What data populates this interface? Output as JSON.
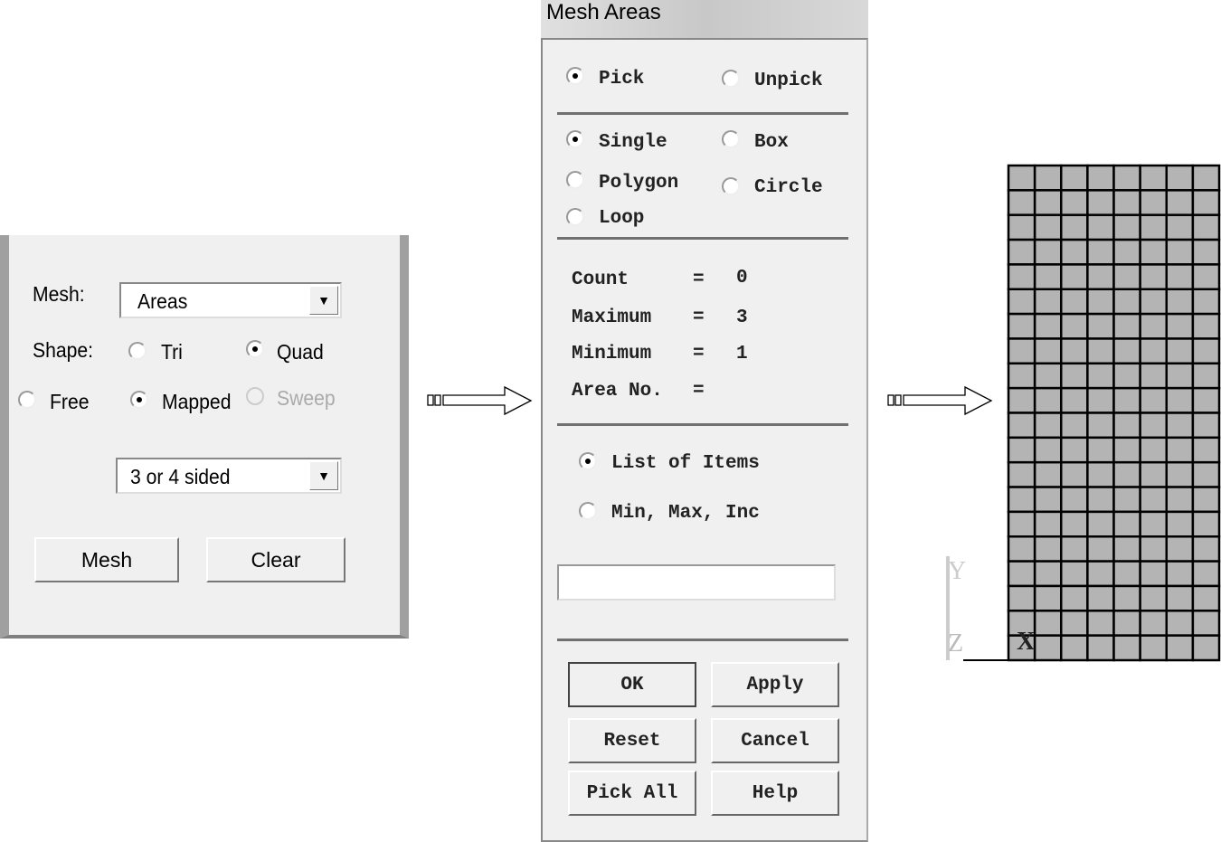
{
  "left_panel": {
    "mesh_label": "Mesh:",
    "mesh_value": "Areas",
    "shape_label": "Shape:",
    "shape_options": [
      {
        "label": "Tri",
        "selected": false
      },
      {
        "label": "Quad",
        "selected": true
      }
    ],
    "method_options": [
      {
        "label": "Free",
        "selected": false
      },
      {
        "label": "Mapped",
        "selected": true
      },
      {
        "label": "Sweep",
        "selected": false,
        "disabled": true
      }
    ],
    "sides_value": "3 or 4 sided",
    "mesh_button": "Mesh",
    "clear_button": "Clear"
  },
  "dialog": {
    "title": "Mesh Areas",
    "pick": "Pick",
    "unpick": "Unpick",
    "single": "Single",
    "box": "Box",
    "polygon": "Polygon",
    "circle": "Circle",
    "loop": "Loop",
    "count_label": "Count",
    "count_value": "0",
    "maximum_label": "Maximum",
    "maximum_value": "3",
    "minimum_label": "Minimum",
    "minimum_value": "1",
    "area_no_label": "Area No.",
    "eq": "=",
    "list_of_items": "List of Items",
    "min_max_inc": "Min, Max, Inc",
    "input_value": "",
    "buttons": {
      "ok": "OK",
      "apply": "Apply",
      "reset": "Reset",
      "cancel": "Cancel",
      "pick_all": "Pick All",
      "help": "Help"
    }
  },
  "mesh_view": {
    "columns": 8,
    "rows": 20,
    "fill_color": "#b4b4b4",
    "axis_labels": {
      "y": "Y",
      "z": "Z",
      "x": "X"
    }
  }
}
